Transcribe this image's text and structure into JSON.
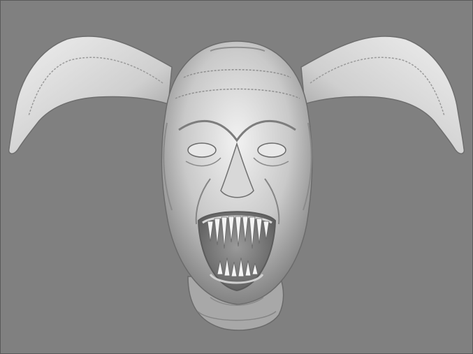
{
  "scene": {
    "background_color": "#808080",
    "model_color": "#e6e6e6",
    "shadow_color": "#5c5c5c",
    "subject": "gray-sculpted-horned-demon-head-icon"
  }
}
